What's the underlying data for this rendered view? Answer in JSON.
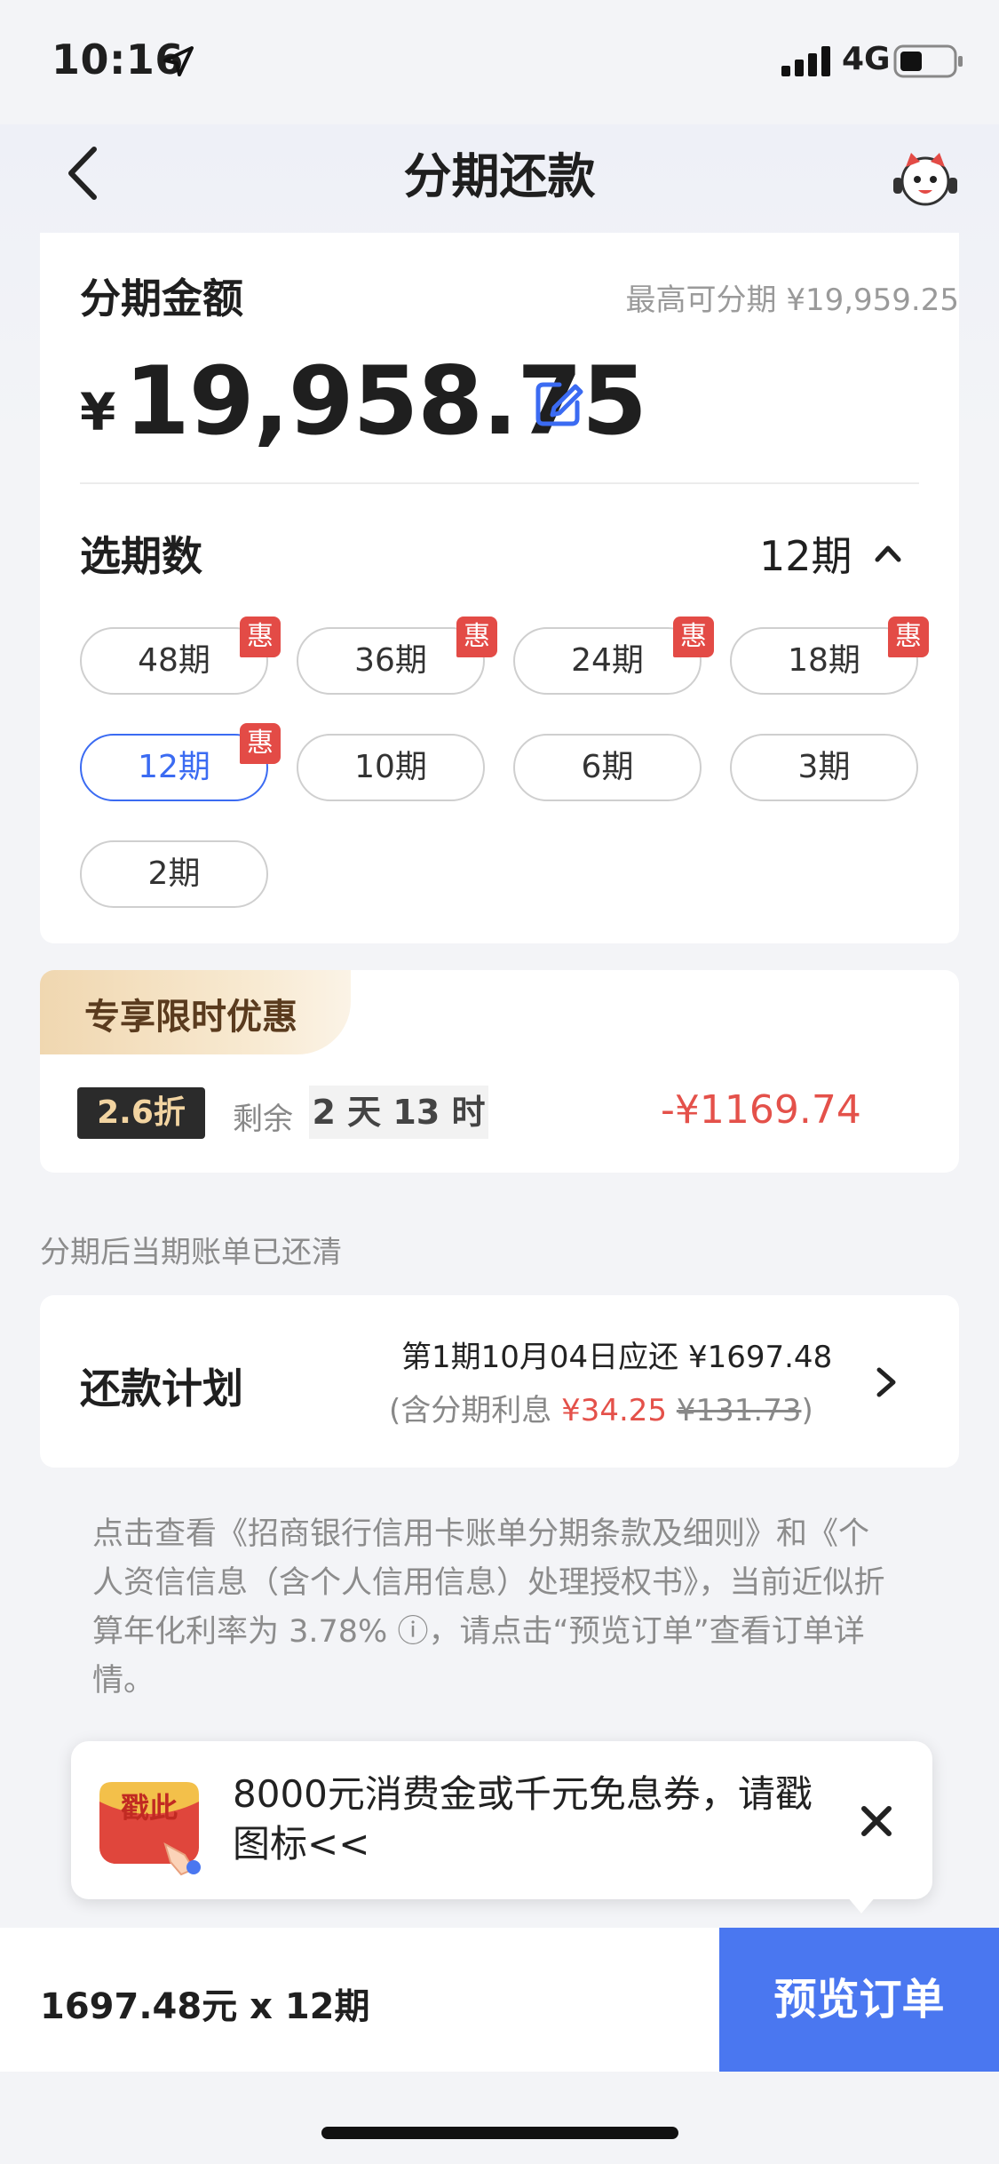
{
  "status_bar": {
    "time": "10:16",
    "network": "4G"
  },
  "nav": {
    "title": "分期还款"
  },
  "amount": {
    "title": "分期金额",
    "max_text": "最高可分期 ¥19,959.25",
    "currency": "¥",
    "value": "19,958.75"
  },
  "period": {
    "label": "选期数",
    "selected": "12期",
    "options": [
      {
        "label": "48期",
        "badge": "惠"
      },
      {
        "label": "36期",
        "badge": "惠"
      },
      {
        "label": "24期",
        "badge": "惠"
      },
      {
        "label": "18期",
        "badge": "惠"
      },
      {
        "label": "12期",
        "badge": "惠",
        "selected": true
      },
      {
        "label": "10期"
      },
      {
        "label": "6期"
      },
      {
        "label": "3期"
      },
      {
        "label": "2期"
      }
    ]
  },
  "promo": {
    "tag": "专享限时优惠",
    "discount": "2.6折",
    "remain_label": "剩余",
    "remain_time": "2 天 13 时",
    "saving": "-¥1169.74"
  },
  "note": "分期后当期账单已还清",
  "plan": {
    "title": "还款计划",
    "line1": "第1期10月04日应还 ¥1697.48",
    "line2_prefix": "(含分期利息 ",
    "interest": "¥34.25",
    "original_interest": "¥131.73",
    "line2_suffix": ")"
  },
  "terms": "点击查看《招商银行信用卡账单分期条款及细则》和《个人资信信息（含个人信用信息）处理授权书》，当前近似折算年化利率为 3.78% ⓘ，请点击“预览订单”查看订单详情。",
  "bubble": {
    "icon_text": "戳此",
    "text": "8000元消费金或千元免息券，请戳图标<<"
  },
  "bottom": {
    "summary": "1697.48元 x 12期",
    "button": "预览订单"
  },
  "colors": {
    "accent": "#4a77f0",
    "red": "#e4514a",
    "badge": "#e34b46"
  }
}
